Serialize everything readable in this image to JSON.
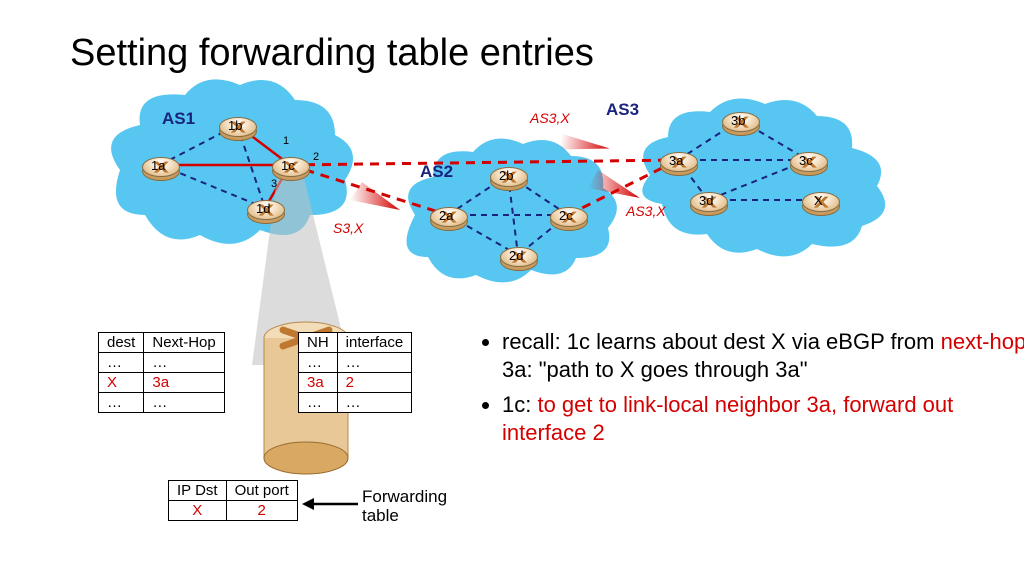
{
  "title": "Setting forwarding table entries",
  "as_labels": {
    "as1": "AS1",
    "as2": "AS2",
    "as3": "AS3"
  },
  "routers": {
    "r1a": "1a",
    "r1b": "1b",
    "r1c": "1c",
    "r1d": "1d",
    "r2a": "2a",
    "r2b": "2b",
    "r2c": "2c",
    "r2d": "2d",
    "r3a": "3a",
    "r3b": "3b",
    "r3c": "3c",
    "r3d": "3d",
    "rx": "X"
  },
  "ports": {
    "p1": "1",
    "p2": "2",
    "p3": "3"
  },
  "messages": {
    "m1": "AS3,X",
    "m2": "AS3,X",
    "m3": "S3,X"
  },
  "table_bgp": {
    "h_dest": "dest",
    "h_nh": "Next-Hop",
    "r1c0": "…",
    "r1c1": "…",
    "r2c0": "X",
    "r2c1": "3a",
    "r3c0": "…",
    "r3c1": "…"
  },
  "table_if": {
    "h_nh": "NH",
    "h_if": "interface",
    "r1c0": "…",
    "r1c1": "…",
    "r2c0": "3a",
    "r2c1": "2",
    "r3c0": "…",
    "r3c1": "…"
  },
  "table_fwd": {
    "h_ip": "IP Dst",
    "h_out": "Out port",
    "r1c0": "X",
    "r1c1": "2"
  },
  "ft_label": "Forwarding\ntable",
  "bullets": {
    "b1a": "recall: 1c learns about dest X via eBGP from ",
    "b1b": "next-hop",
    "b1c": " 3a: \"path to X goes through 3a\"",
    "b2a": "1c: ",
    "b2b": "to get to link-local neighbor 3a, forward out interface 2"
  }
}
